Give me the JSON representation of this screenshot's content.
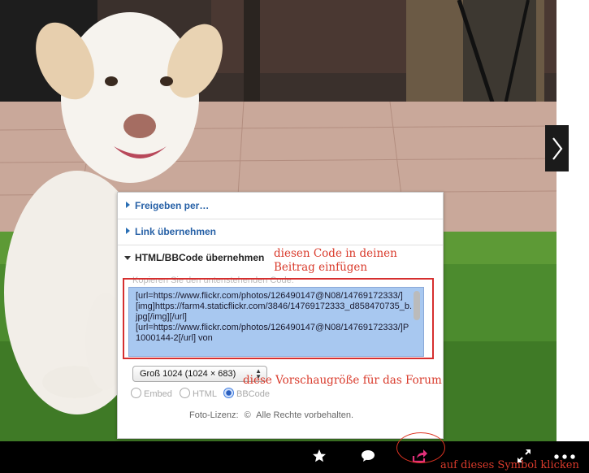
{
  "colors": {
    "link_blue": "#2660a6",
    "annotation_red": "#d93a2b",
    "selection_blue": "#a8c8f0",
    "share_pink": "#e2307a"
  },
  "share_panel": {
    "items": [
      {
        "label": "Freigeben per…"
      },
      {
        "label": "Link übernehmen"
      },
      {
        "label": "HTML/BBCode übernehmen"
      }
    ],
    "copy_hint": "Kopieren Sie den untenstehenden Code:",
    "code_text": "[url=https://www.flickr.com/photos/126490147@N08/14769172333/]\n[img]https://farm4.staticflickr.com/3846/14769172333_d858470735_b.jpg[/img][/url]\n[url=https://www.flickr.com/photos/126490147@N08/14769172333/]P1000144-2[/url] von",
    "size_select": {
      "value": "Groß 1024 (1024 × 683)"
    },
    "formats": [
      {
        "label": "Embed",
        "selected": false
      },
      {
        "label": "HTML",
        "selected": false
      },
      {
        "label": "BBCode",
        "selected": true
      }
    ],
    "license": {
      "label": "Foto-Lizenz:",
      "symbol": "©",
      "text": "Alle Rechte vorbehalten."
    }
  },
  "annotations": {
    "code_hint_line1": "diesen Code in deinen",
    "code_hint_line2": "Beitrag einfügen",
    "size_hint": "diese Vorschaugröße für das Forum",
    "share_hint": "auf dieses Symbol klicken"
  },
  "toolbar": {
    "icons": [
      "star-icon",
      "comment-icon",
      "share-icon",
      "expand-icon",
      "more-icon"
    ]
  },
  "nav": {
    "next_glyph": "›"
  }
}
